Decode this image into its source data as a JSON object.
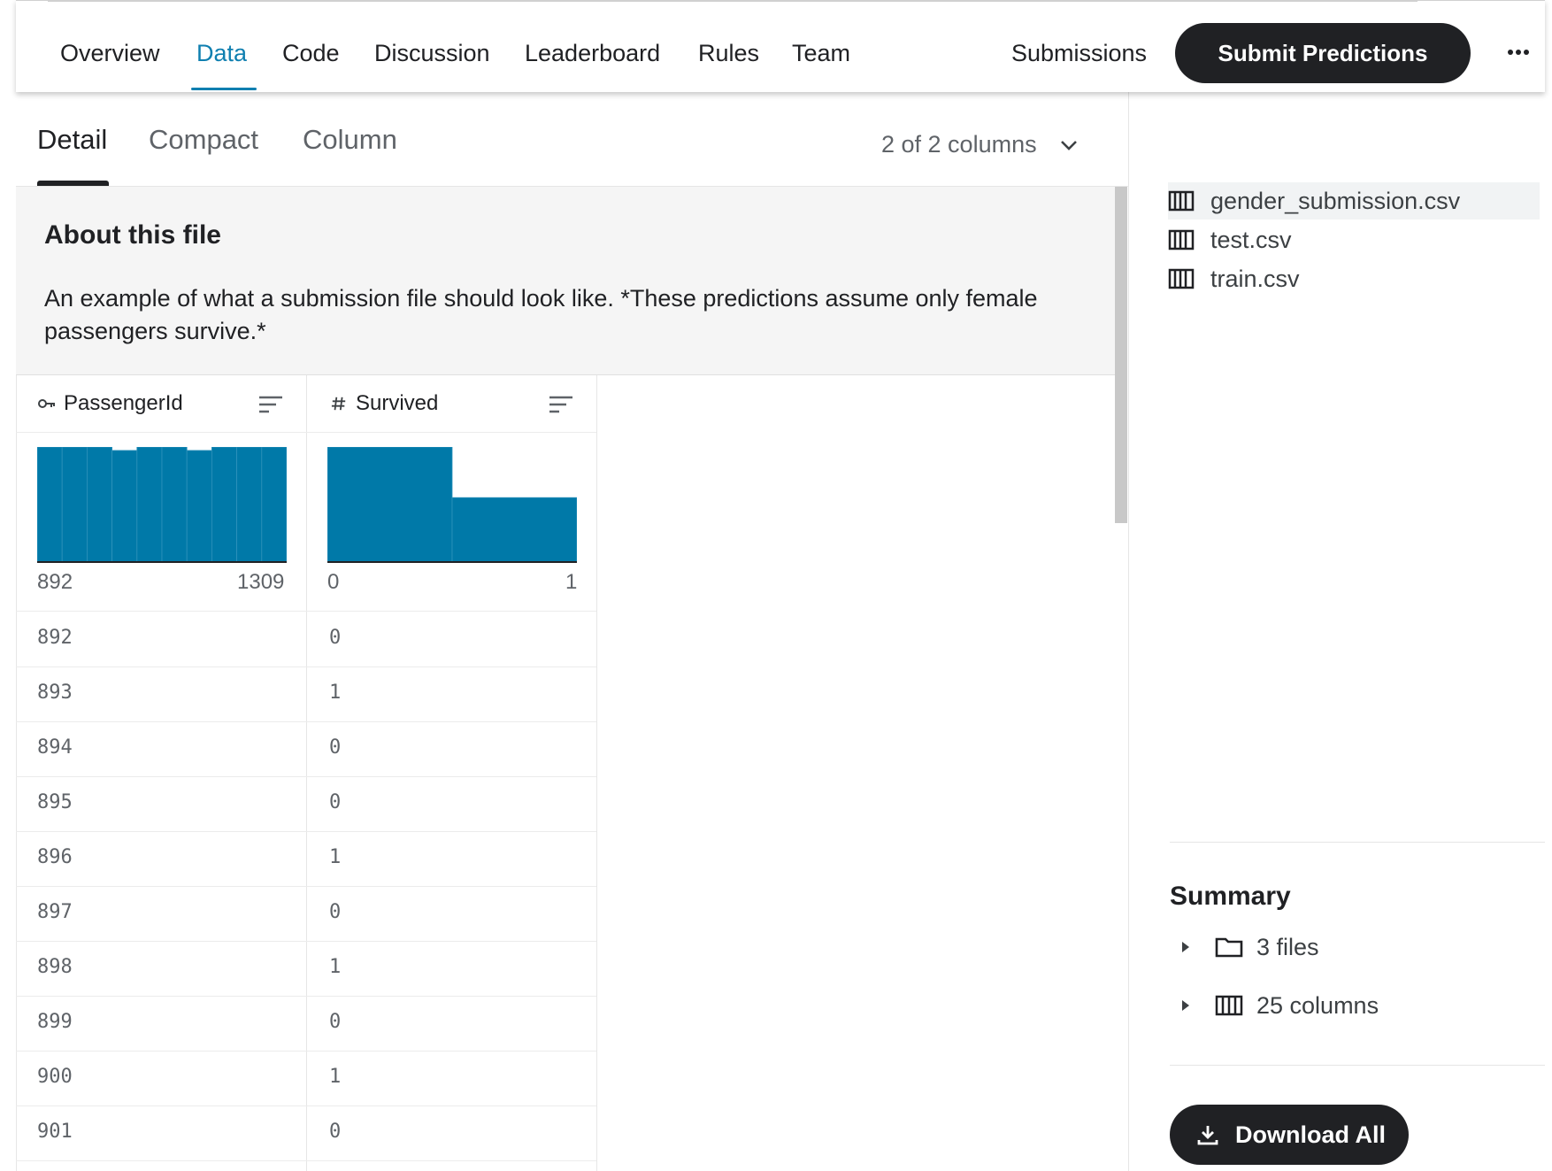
{
  "nav": {
    "tabs": [
      "Overview",
      "Data",
      "Code",
      "Discussion",
      "Leaderboard",
      "Rules",
      "Team"
    ],
    "submissions": "Submissions",
    "submit_label": "Submit Predictions",
    "accent_color": "#0f7fb0"
  },
  "views": {
    "tabs": [
      "Detail",
      "Compact",
      "Column"
    ],
    "columns_label": "2 of 2 columns"
  },
  "about": {
    "title": "About this file",
    "text": "An example of what a submission file should look like. *These predictions assume only female passengers survive.*"
  },
  "files": [
    "gender_submission.csv",
    "test.csv",
    "train.csv"
  ],
  "summary": {
    "title": "Summary",
    "files": "3 files",
    "columns": "25 columns"
  },
  "download_label": "Download All",
  "table": {
    "columns": [
      {
        "name": "PassengerId",
        "type_icon": "key-icon",
        "min": "892",
        "max": "1309"
      },
      {
        "name": "Survived",
        "type_icon": "hash-icon",
        "min": "0",
        "max": "1"
      }
    ],
    "rows": [
      [
        "892",
        "0"
      ],
      [
        "893",
        "1"
      ],
      [
        "894",
        "0"
      ],
      [
        "895",
        "0"
      ],
      [
        "896",
        "1"
      ],
      [
        "897",
        "0"
      ],
      [
        "898",
        "1"
      ],
      [
        "899",
        "0"
      ],
      [
        "900",
        "1"
      ],
      [
        "901",
        "0"
      ]
    ]
  },
  "chart_data": [
    {
      "type": "bar",
      "title": "PassengerId",
      "values": [
        1,
        1,
        1,
        0.97,
        1,
        1,
        0.97,
        1,
        1,
        1
      ],
      "bar_color": "#0079a8"
    },
    {
      "type": "bar",
      "title": "Survived",
      "values": [
        1,
        0.56
      ],
      "bar_color": "#0079a8"
    }
  ]
}
